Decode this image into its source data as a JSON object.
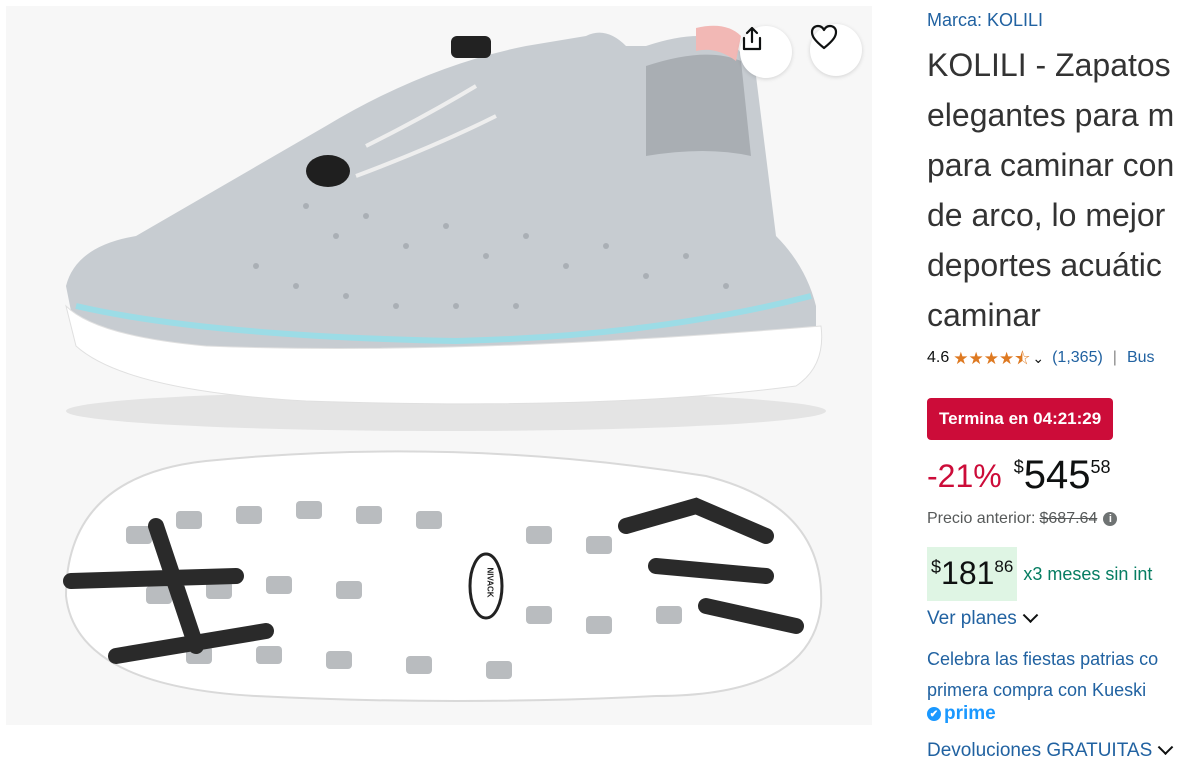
{
  "brand": {
    "label": "Marca: KOLILI"
  },
  "product": {
    "title": "KOLILI - Zapatos elegantes para mujer, para caminar con soporte de arco, lo mejor para deportes acuáticos, caminar",
    "title_lines": [
      "KOLILI - Zapatos",
      "elegantes para m",
      "para caminar con",
      "de arco, lo mejor",
      "deportes acuátic",
      "caminar"
    ]
  },
  "image": {
    "sole_logo_text": "NIVACK"
  },
  "rating": {
    "value": "4.6",
    "stars": 4.5,
    "count": "(1,365)",
    "separator": "|",
    "extra": "Bus"
  },
  "deal": {
    "badge": "Termina en 04:21:29",
    "color": "#cc0c39"
  },
  "price": {
    "discount": "-21%",
    "symbol": "$",
    "whole": "545",
    "fraction": "58",
    "previous_label": "Precio anterior:",
    "previous_value": "$687.64"
  },
  "installments": {
    "symbol": "$",
    "whole": "181",
    "fraction": "86",
    "text": "x3 meses sin int"
  },
  "plans": {
    "label": "Ver planes"
  },
  "promo": {
    "line1": "Celebra las fiestas patrias co",
    "line2": "primera compra con Kueski"
  },
  "prime": {
    "label": "prime"
  },
  "returns": {
    "label": "Devoluciones GRATUITAS"
  },
  "colors": {
    "link": "#2162a1",
    "deal": "#cc0c39",
    "installment_bg": "#dff5e4",
    "prime": "#1a98ff",
    "star": "#de7921"
  }
}
